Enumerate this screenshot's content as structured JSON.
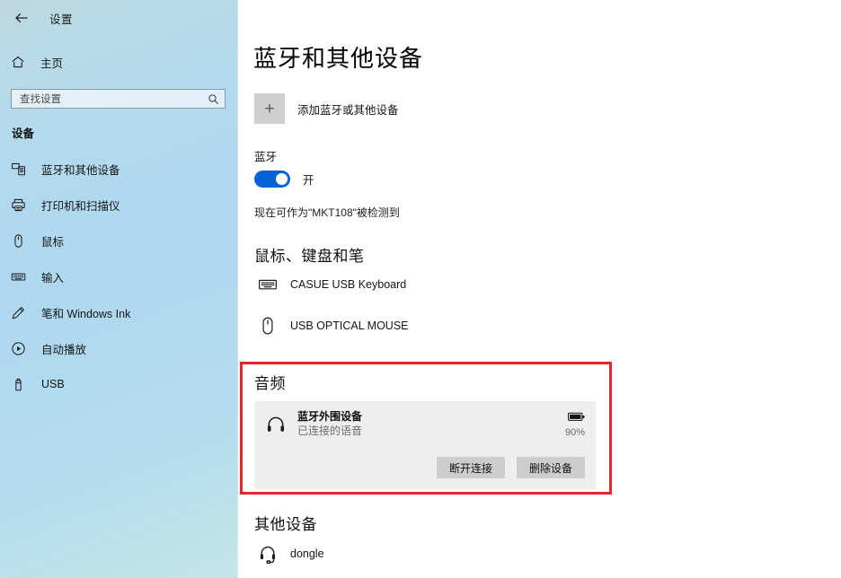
{
  "window": {
    "app_title": "设置",
    "back_icon": "back-arrow-icon"
  },
  "sidebar": {
    "home": {
      "label": "主页",
      "icon": "home-icon"
    },
    "search": {
      "placeholder": "查找设置",
      "icon": "search-icon"
    },
    "section_label": "设备",
    "items": [
      {
        "label": "蓝牙和其他设备",
        "icon": "bluetooth-devices-icon",
        "selected": true
      },
      {
        "label": "打印机和扫描仪",
        "icon": "printer-icon",
        "selected": false
      },
      {
        "label": "鼠标",
        "icon": "mouse-icon",
        "selected": false
      },
      {
        "label": "输入",
        "icon": "keyboard-typing-icon",
        "selected": false
      },
      {
        "label": "笔和 Windows Ink",
        "icon": "pen-icon",
        "selected": false
      },
      {
        "label": "自动播放",
        "icon": "autoplay-icon",
        "selected": false
      },
      {
        "label": "USB",
        "icon": "usb-icon",
        "selected": false
      }
    ]
  },
  "main": {
    "page_title": "蓝牙和其他设备",
    "add_device": {
      "label": "添加蓝牙或其他设备",
      "icon": "plus-icon"
    },
    "bluetooth": {
      "label": "蓝牙",
      "toggle_state": "开",
      "toggle_on": true,
      "toggle_color": "#0a63d6",
      "discoverable_text": "现在可作为\"MKT108\"被检测到"
    },
    "groups": [
      {
        "heading": "鼠标、键盘和笔",
        "devices": [
          {
            "name": "CASUE USB Keyboard",
            "icon": "keyboard-icon"
          },
          {
            "name": "USB OPTICAL MOUSE",
            "icon": "mouse-icon"
          }
        ]
      }
    ],
    "audio": {
      "heading": "音频",
      "highlight_color": "#e8262a",
      "device": {
        "name": "蓝牙外围设备",
        "status": "已连接的语音",
        "icon": "headphones-icon",
        "battery_icon": "battery-icon",
        "battery_percent": "90%"
      },
      "actions": [
        {
          "label": "断开连接"
        },
        {
          "label": "删除设备"
        }
      ]
    },
    "other": {
      "heading": "其他设备",
      "devices": [
        {
          "name": "dongle",
          "icon": "headset-icon"
        }
      ]
    }
  }
}
